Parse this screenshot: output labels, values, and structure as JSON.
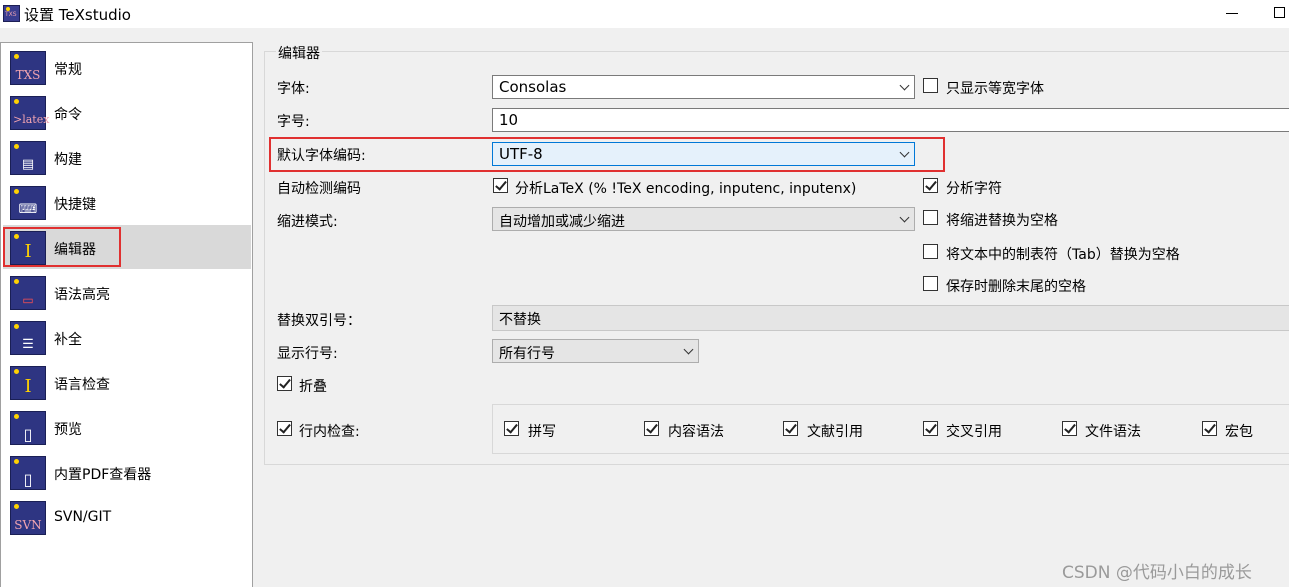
{
  "window": {
    "title": "设置 TeXstudio"
  },
  "sidebar": {
    "items": [
      {
        "label": "常规",
        "icon": "txs-icon",
        "glyph": "TXS"
      },
      {
        "label": "命令",
        "icon": "latex-icon",
        "glyph": ">latex"
      },
      {
        "label": "构建",
        "icon": "build-icon",
        "glyph": "▤"
      },
      {
        "label": "快捷键",
        "icon": "keyboard-icon",
        "glyph": "⌨"
      },
      {
        "label": "编辑器",
        "icon": "editor-cursor-icon",
        "glyph": "I"
      },
      {
        "label": "语法高亮",
        "icon": "syntax-highlight-icon",
        "glyph": "▭"
      },
      {
        "label": "补全",
        "icon": "completion-icon",
        "glyph": "☰"
      },
      {
        "label": "语言检查",
        "icon": "language-check-icon",
        "glyph": "I"
      },
      {
        "label": "预览",
        "icon": "preview-icon",
        "glyph": "▯"
      },
      {
        "label": "内置PDF查看器",
        "icon": "pdf-viewer-icon",
        "glyph": "▯"
      },
      {
        "label": "SVN/GIT",
        "icon": "svn-icon",
        "glyph": "SVN"
      }
    ],
    "selected_index": 4
  },
  "editor": {
    "group_title": "编辑器",
    "font_label": "字体:",
    "font_value": "Consolas",
    "monospace_only_label": "只显示等宽字体",
    "font_size_label": "字号:",
    "font_size_value": "10",
    "default_encoding_label": "默认字体编码:",
    "default_encoding_value": "UTF-8",
    "auto_detect_label": "自动检测编码",
    "analyze_latex_label": "分析LaTeX (% !TeX encoding, inputenc, inputenx)",
    "analyze_chars_label": "分析字符",
    "indent_mode_label": "缩进模式:",
    "indent_mode_value": "自动增加或减少缩进",
    "indent_to_space_label": "将缩进替换为空格",
    "tab_to_space_label": "将文本中的制表符（Tab）替换为空格",
    "trim_trailing_label": "保存时删除末尾的空格",
    "replace_quotes_label": "替换双引号：",
    "replace_quotes_value": "不替换",
    "show_line_numbers_label": "显示行号:",
    "show_line_numbers_value": "所有行号",
    "folding_label": "折叠",
    "inline_check_label": "行内检查:",
    "inline_checks": [
      "拼写",
      "内容语法",
      "文献引用",
      "交叉引用",
      "文件语法",
      "宏包"
    ]
  },
  "checkbox_states": {
    "monospace_only": false,
    "analyze_latex": true,
    "analyze_chars": true,
    "indent_to_space": false,
    "tab_to_space": false,
    "trim_trailing": false,
    "folding": true,
    "inline_check": true,
    "inline_checks": [
      true,
      true,
      true,
      true,
      true,
      true
    ]
  },
  "watermark": "CSDN @代码小白的成长",
  "colors": {
    "highlight_box": "#e03030",
    "focus_border": "#0078d7"
  }
}
